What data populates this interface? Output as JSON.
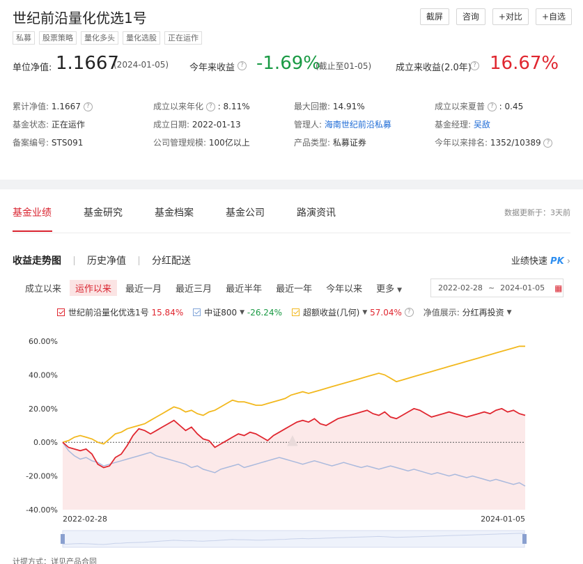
{
  "header": {
    "title": "世纪前沿量化优选1号",
    "tags": [
      "私募",
      "股票策略",
      "量化多头",
      "量化选股",
      "正在运作"
    ],
    "buttons": [
      "截屏",
      "咨询",
      "+对比",
      "+自选"
    ]
  },
  "summary": {
    "nav_label": "单位净值:",
    "nav_value": "1.1667",
    "nav_date": "(2024-01-05)",
    "ytd_label": "今年来收益",
    "ytd_value": "-1.69%",
    "ytd_note": "(截止至01-05)",
    "since_label": "成立来收益(2.0年)",
    "since_value": "16.67%",
    "colors": {
      "up": "#e0262f",
      "down": "#1a9a44"
    }
  },
  "details": [
    {
      "k": "累计净值:",
      "v": "1.1667",
      "q": true
    },
    {
      "k": "成立以来年化",
      "v": ": 8.11%",
      "q": true
    },
    {
      "k": "最大回撤:",
      "v": "14.91%"
    },
    {
      "k": "成立以来夏普",
      "v": ": 0.45",
      "q": true
    },
    {
      "k": "基金状态:",
      "v": "正在运作"
    },
    {
      "k": "成立日期:",
      "v": "2022-01-13"
    },
    {
      "k": "管理人:",
      "v": "海南世纪前沿私募",
      "link": true
    },
    {
      "k": "基金经理:",
      "v": "吴敌",
      "link": true
    },
    {
      "k": "备案编号:",
      "v": "STS091"
    },
    {
      "k": "公司管理规模:",
      "v": "100亿以上"
    },
    {
      "k": "产品类型:",
      "v": "私募证券"
    },
    {
      "k": "今年以来排名:",
      "v": "1352/10389",
      "q": true
    }
  ],
  "tabs": [
    "基金业绩",
    "基金研究",
    "基金档案",
    "基金公司",
    "路演资讯"
  ],
  "update_note": "数据更新于：3天前",
  "subtabs": [
    "收益走势图",
    "历史净值",
    "分红配送"
  ],
  "quick": {
    "label": "业绩快速",
    "pk": "PK"
  },
  "periods": [
    "成立以来",
    "运作以来",
    "最近一月",
    "最近三月",
    "最近半年",
    "最近一年",
    "今年以来",
    "更多"
  ],
  "date_range": {
    "start": "2022-02-28",
    "sep": "~",
    "end": "2024-01-05"
  },
  "legend": {
    "fund": {
      "name": "世纪前沿量化优选1号",
      "value": "15.84%"
    },
    "bench": {
      "name": "中证800",
      "value": "-26.24%"
    },
    "excess": {
      "name": "超额收益(几何)",
      "value": "57.04%"
    },
    "nav_show_label": "净值展示:",
    "nav_show_value": "分红再投资"
  },
  "footer_text": "计提方式：详见产品合同",
  "chart_data": {
    "type": "line",
    "x_labels": [
      "2022-02-28",
      "2024-01-05"
    ],
    "y_ticks": [
      "60.00%",
      "40.00%",
      "20.00%",
      "0.00%",
      "-20.00%",
      "-40.00%"
    ],
    "ylim": [
      -40,
      60
    ],
    "series": [
      {
        "name": "世纪前沿量化优选1号",
        "color": "#e0262f",
        "values": [
          0,
          -3,
          -4,
          -5,
          -4,
          -7,
          -13,
          -15,
          -14,
          -9,
          -7,
          -2,
          4,
          8,
          7,
          5,
          7,
          9,
          11,
          13,
          10,
          7,
          9,
          5,
          2,
          1,
          -3,
          -1,
          1,
          3,
          5,
          4,
          6,
          5,
          3,
          1,
          4,
          6,
          8,
          10,
          12,
          13,
          12,
          14,
          11,
          10,
          12,
          14,
          15,
          16,
          17,
          18,
          19,
          17,
          16,
          18,
          15,
          14,
          16,
          18,
          20,
          19,
          17,
          15,
          16,
          17,
          18,
          17,
          16,
          15,
          16,
          17,
          18,
          17,
          19,
          20,
          18,
          19,
          17,
          16
        ]
      },
      {
        "name": "中证800",
        "color": "#a9b9dd",
        "values": [
          0,
          -5,
          -8,
          -10,
          -9,
          -11,
          -12,
          -14,
          -13,
          -12,
          -11,
          -10,
          -9,
          -8,
          -7,
          -6,
          -8,
          -9,
          -10,
          -11,
          -12,
          -13,
          -15,
          -14,
          -16,
          -17,
          -18,
          -16,
          -15,
          -14,
          -13,
          -15,
          -14,
          -13,
          -12,
          -11,
          -10,
          -9,
          -10,
          -11,
          -12,
          -13,
          -12,
          -11,
          -12,
          -13,
          -14,
          -13,
          -12,
          -13,
          -14,
          -15,
          -14,
          -15,
          -16,
          -15,
          -14,
          -15,
          -16,
          -17,
          -16,
          -17,
          -18,
          -19,
          -18,
          -19,
          -20,
          -19,
          -20,
          -21,
          -20,
          -21,
          -22,
          -23,
          -22,
          -23,
          -24,
          -25,
          -24,
          -26
        ]
      },
      {
        "name": "超额收益(几何)",
        "color": "#f2b81d",
        "values": [
          0,
          1,
          3,
          4,
          3,
          2,
          0,
          -1,
          2,
          5,
          6,
          8,
          9,
          10,
          11,
          13,
          15,
          17,
          19,
          21,
          20,
          18,
          19,
          17,
          16,
          18,
          19,
          21,
          23,
          25,
          24,
          24,
          23,
          22,
          22,
          23,
          24,
          25,
          26,
          28,
          29,
          30,
          29,
          30,
          31,
          32,
          33,
          34,
          35,
          36,
          37,
          38,
          39,
          40,
          41,
          40,
          38,
          36,
          37,
          38,
          39,
          40,
          41,
          42,
          43,
          44,
          45,
          46,
          47,
          48,
          49,
          50,
          51,
          52,
          53,
          54,
          55,
          56,
          57,
          57
        ]
      }
    ]
  }
}
